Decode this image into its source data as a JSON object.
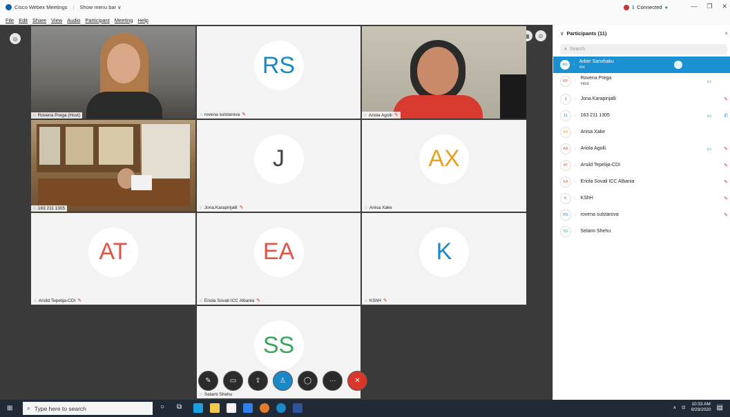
{
  "titlebar": {
    "app_name": "Cisco Webex Meetings",
    "show_menu": "Show menu bar ∨",
    "connection": "Connected",
    "dot": "●",
    "minimize": "—",
    "maximize": "❐",
    "close": "✕"
  },
  "menu": [
    "File",
    "Edit",
    "Share",
    "View",
    "Audio",
    "Participant",
    "Meeting",
    "Help"
  ],
  "tiles": [
    {
      "name": "Rovena Prega (Host)",
      "type": "video"
    },
    {
      "name": "rovena sulstarova",
      "initials": "RS",
      "color": "#1b88c7",
      "muted": true
    },
    {
      "name": "Ariola Agolli",
      "type": "video",
      "muted": true
    },
    {
      "name": "163 211 1305",
      "type": "video"
    },
    {
      "name": "Jona.Karapinjalli",
      "initials": "J",
      "color": "#444444",
      "muted": true
    },
    {
      "name": "Anisa Xake",
      "initials": "AX",
      "color": "#e8a020"
    },
    {
      "name": "Arsild Tepelija-CDI",
      "initials": "AT",
      "color": "#e05545",
      "muted": true
    },
    {
      "name": "Eriola Sovali ICC Albania",
      "initials": "EA",
      "color": "#e05545",
      "muted": true
    },
    {
      "name": "KShH",
      "initials": "K",
      "color": "#1b88c7",
      "muted": true
    },
    {
      "name": "Selami Shehu",
      "initials": "SS",
      "color": "#3aa55c"
    }
  ],
  "participants_panel": {
    "title": "Participants (11)",
    "search_placeholder": "Search",
    "rows": [
      {
        "initials": "AS",
        "name": "Arber Sanxhaku",
        "sub": "Me"
      },
      {
        "initials": "RP",
        "name": "Rovena Prega",
        "sub": "Host",
        "camera": true
      },
      {
        "initials": "J",
        "name": "Jona.Karapinjalli",
        "muted": true
      },
      {
        "initials": "11",
        "name": "163 211 1305",
        "camera": true
      },
      {
        "initials": "AX",
        "name": "Anisa Xake"
      },
      {
        "initials": "AA",
        "name": "Ariola Agolli",
        "camera": true,
        "muted": true
      },
      {
        "initials": "AT",
        "name": "Arsild Tepelija-CDI",
        "muted": true
      },
      {
        "initials": "EA",
        "name": "Eriola Sovali ICC Albania",
        "muted": true
      },
      {
        "initials": "K",
        "name": "KShH",
        "muted": true
      },
      {
        "initials": "RS",
        "name": "rovena sulstarova",
        "muted": true
      },
      {
        "initials": "SS",
        "name": "Selami Shehu"
      }
    ]
  },
  "controls": [
    "mute-icon",
    "video-icon",
    "share-icon",
    "participants-icon",
    "chat-icon",
    "more-icon",
    "end-call-icon"
  ],
  "taskbar": {
    "search_placeholder": "Type here to search",
    "time": "10:33 AM",
    "date": "9/29/2020"
  },
  "colors": {
    "accent": "#1b91d2",
    "stage_bg": "#3a3a3a",
    "taskbar_bg": "#1f2a36",
    "end_call": "#d9362c"
  }
}
